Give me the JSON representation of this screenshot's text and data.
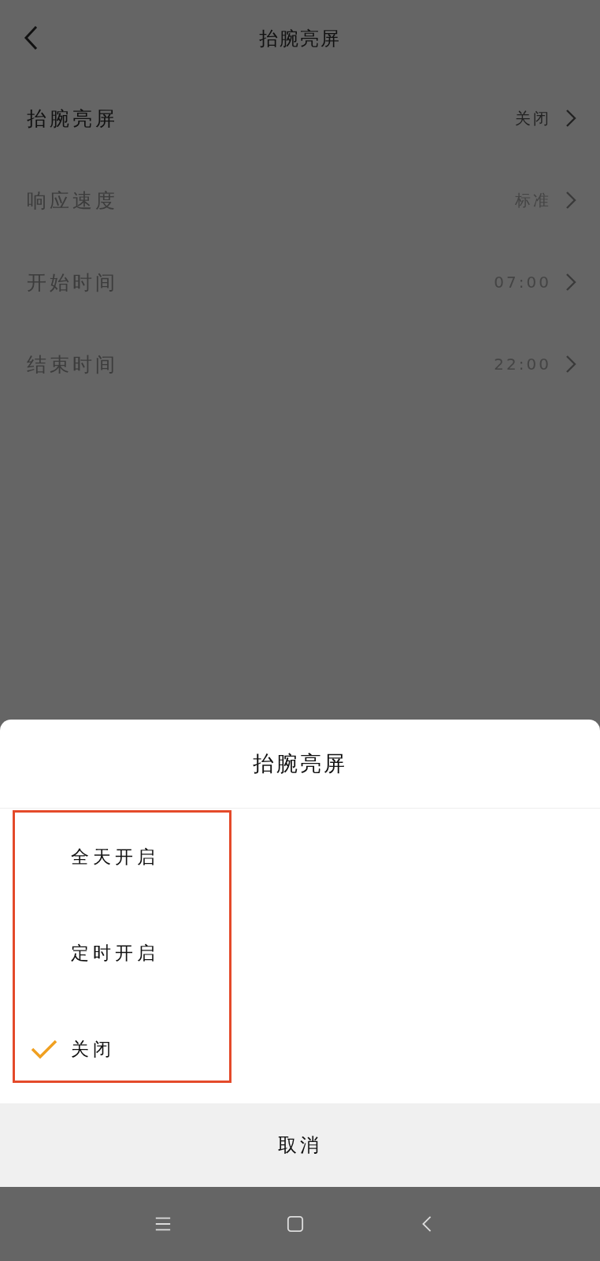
{
  "header": {
    "title": "抬腕亮屏"
  },
  "settings": [
    {
      "label": "抬腕亮屏",
      "value": "关闭",
      "disabled": false
    },
    {
      "label": "响应速度",
      "value": "标准",
      "disabled": true
    },
    {
      "label": "开始时间",
      "value": "07:00",
      "disabled": true
    },
    {
      "label": "结束时间",
      "value": "22:00",
      "disabled": true
    }
  ],
  "sheet": {
    "title": "抬腕亮屏",
    "options": [
      {
        "label": "全天开启",
        "selected": false
      },
      {
        "label": "定时开启",
        "selected": false
      },
      {
        "label": "关闭",
        "selected": true
      }
    ],
    "highlight_frame": true,
    "cancel": "取消"
  }
}
